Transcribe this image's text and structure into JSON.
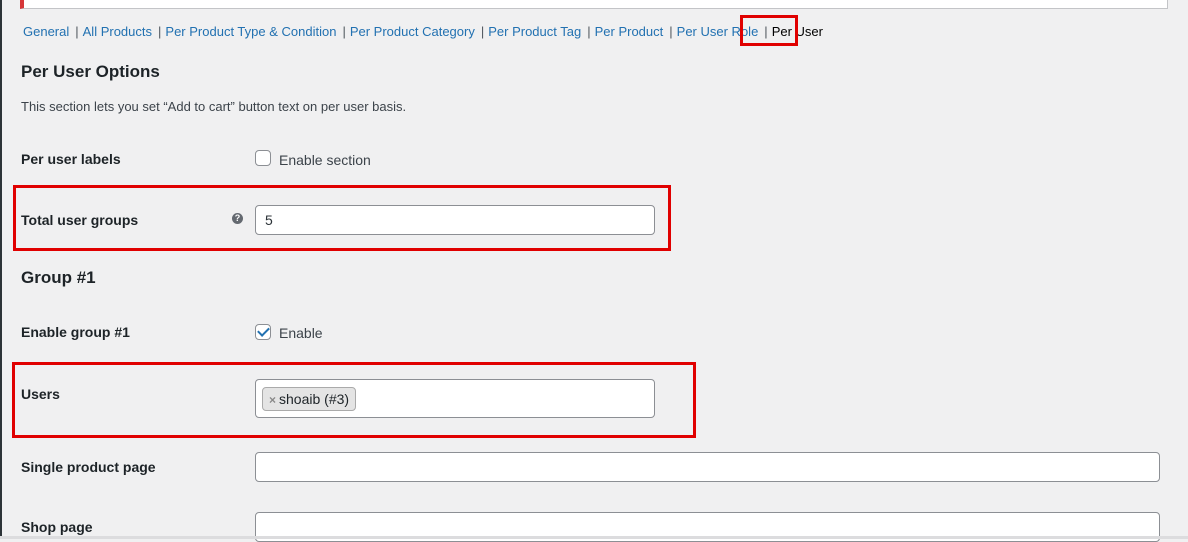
{
  "nav": {
    "items": [
      {
        "label": "General"
      },
      {
        "label": "All Products"
      },
      {
        "label": "Per Product Type & Condition"
      },
      {
        "label": "Per Product Category"
      },
      {
        "label": "Per Product Tag"
      },
      {
        "label": "Per Product"
      },
      {
        "label": "Per User Role"
      },
      {
        "label": "Per User"
      }
    ],
    "separator": "|"
  },
  "section": {
    "title": "Per User Options",
    "description": "This section lets you set “Add to cart” button text on per user basis."
  },
  "fields": {
    "per_user_labels": {
      "label": "Per user labels",
      "checkbox_label": "Enable section",
      "checked": false
    },
    "total_user_groups": {
      "label": "Total user groups",
      "value": "5",
      "help_icon": "question-circle-icon",
      "help_glyph": "?"
    }
  },
  "group": {
    "title": "Group #1",
    "enable": {
      "label": "Enable group #1",
      "checkbox_label": "Enable",
      "checked": true
    },
    "users": {
      "label": "Users",
      "remove_glyph": "×",
      "token": "shoaib (#3)"
    },
    "single_product_page": {
      "label": "Single product page",
      "value": ""
    },
    "shop_page": {
      "label": "Shop page",
      "value": ""
    }
  },
  "colors": {
    "link": "#2271b1",
    "highlight": "#e00000",
    "background": "#f0f0f1"
  }
}
